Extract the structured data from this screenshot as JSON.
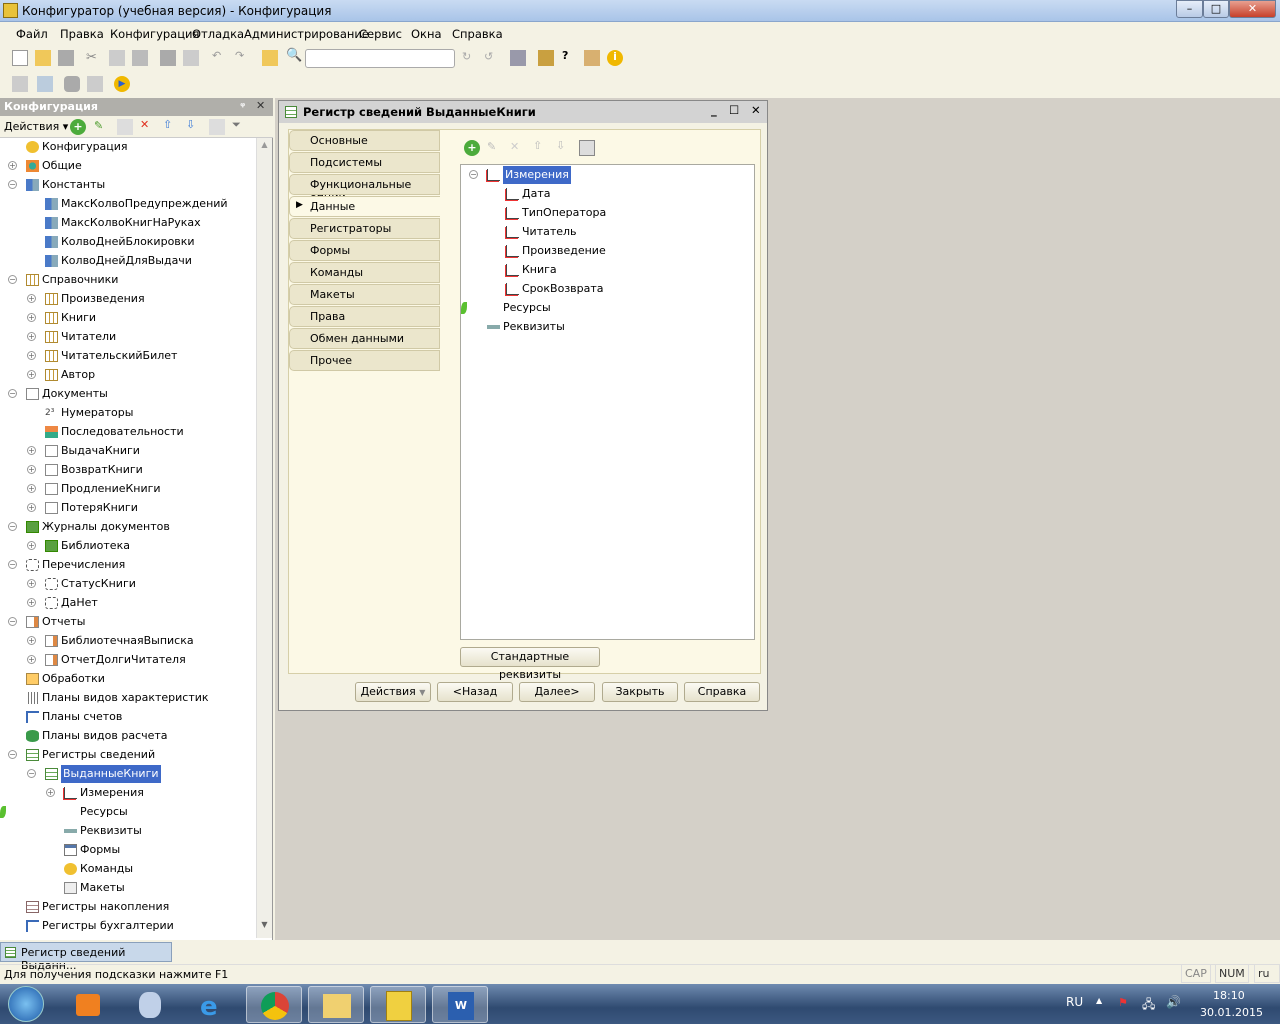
{
  "window": {
    "title": "Конфигуратор (учебная версия) - Конфигурация",
    "minimize": "–",
    "maximize": "□",
    "close": "✕"
  },
  "menu": [
    "Файл",
    "Правка",
    "Конфигурация",
    "Отладка",
    "Администрирование",
    "Сервис",
    "Окна",
    "Справка"
  ],
  "search": {
    "value": ""
  },
  "left_panel": {
    "title": "Конфигурация",
    "pin": "ᵠ",
    "close": "✕",
    "actions": "Действия ▾"
  },
  "tree": [
    {
      "l": 0,
      "e": "",
      "i": "config",
      "t": "Конфигурация"
    },
    {
      "l": 0,
      "e": "+",
      "i": "common",
      "t": "Общие"
    },
    {
      "l": 0,
      "e": "-",
      "i": "const",
      "t": "Константы"
    },
    {
      "l": 1,
      "e": "",
      "i": "const",
      "t": "МаксКолвоПредупреждений"
    },
    {
      "l": 1,
      "e": "",
      "i": "const",
      "t": "МаксКолвоКнигНаРуках"
    },
    {
      "l": 1,
      "e": "",
      "i": "const",
      "t": "КолвоДнейБлокировки"
    },
    {
      "l": 1,
      "e": "",
      "i": "const",
      "t": "КолвоДнейДляВыдачи"
    },
    {
      "l": 0,
      "e": "-",
      "i": "catalog",
      "t": "Справочники"
    },
    {
      "l": 1,
      "e": "+",
      "i": "catalog",
      "t": "Произведения"
    },
    {
      "l": 1,
      "e": "+",
      "i": "catalog",
      "t": "Книги"
    },
    {
      "l": 1,
      "e": "+",
      "i": "catalog",
      "t": "Читатели"
    },
    {
      "l": 1,
      "e": "+",
      "i": "catalog",
      "t": "ЧитательскийБилет"
    },
    {
      "l": 1,
      "e": "+",
      "i": "catalog",
      "t": "Автор"
    },
    {
      "l": 0,
      "e": "-",
      "i": "doc",
      "t": "Документы"
    },
    {
      "l": 1,
      "e": "",
      "i": "numerator",
      "t": "Нумераторы"
    },
    {
      "l": 1,
      "e": "",
      "i": "sequence",
      "t": "Последовательности"
    },
    {
      "l": 1,
      "e": "+",
      "i": "doc",
      "t": "ВыдачаКниги"
    },
    {
      "l": 1,
      "e": "+",
      "i": "doc",
      "t": "ВозвратКниги"
    },
    {
      "l": 1,
      "e": "+",
      "i": "doc",
      "t": "ПродлениеКниги"
    },
    {
      "l": 1,
      "e": "+",
      "i": "doc",
      "t": "ПотеряКниги"
    },
    {
      "l": 0,
      "e": "-",
      "i": "journal",
      "t": "Журналы документов"
    },
    {
      "l": 1,
      "e": "+",
      "i": "journal",
      "t": "Библиотека"
    },
    {
      "l": 0,
      "e": "-",
      "i": "enum",
      "t": "Перечисления"
    },
    {
      "l": 1,
      "e": "+",
      "i": "enum",
      "t": "СтатусКниги"
    },
    {
      "l": 1,
      "e": "+",
      "i": "enum",
      "t": "ДаНет"
    },
    {
      "l": 0,
      "e": "-",
      "i": "report",
      "t": "Отчеты"
    },
    {
      "l": 1,
      "e": "+",
      "i": "report",
      "t": "БиблиотечнаяВыписка"
    },
    {
      "l": 1,
      "e": "+",
      "i": "report",
      "t": "ОтчетДолгиЧитателя"
    },
    {
      "l": 0,
      "e": "",
      "i": "processing",
      "t": "Обработки"
    },
    {
      "l": 0,
      "e": "",
      "i": "chartchar",
      "t": "Планы видов характеристик"
    },
    {
      "l": 0,
      "e": "",
      "i": "accounts",
      "t": "Планы счетов"
    },
    {
      "l": 0,
      "e": "",
      "i": "calc",
      "t": "Планы видов расчета"
    },
    {
      "l": 0,
      "e": "-",
      "i": "inforeg",
      "t": "Регистры сведений"
    },
    {
      "l": 1,
      "e": "-",
      "i": "inforeg",
      "t": "ВыданныеКниги",
      "sel": true
    },
    {
      "l": 2,
      "e": "+",
      "i": "dimension",
      "t": "Измерения"
    },
    {
      "l": 2,
      "e": "",
      "i": "resource",
      "t": "Ресурсы"
    },
    {
      "l": 2,
      "e": "",
      "i": "attribute",
      "t": "Реквизиты"
    },
    {
      "l": 2,
      "e": "",
      "i": "form",
      "t": "Формы"
    },
    {
      "l": 2,
      "e": "",
      "i": "command",
      "t": "Команды"
    },
    {
      "l": 2,
      "e": "",
      "i": "template",
      "t": "Макеты"
    },
    {
      "l": 0,
      "e": "",
      "i": "accumreg",
      "t": "Регистры накопления"
    },
    {
      "l": 0,
      "e": "",
      "i": "accounts",
      "t": "Регистры бухгалтерии"
    }
  ],
  "dialog": {
    "title": "Регистр сведений ВыданныеКниги",
    "tabs": [
      "Основные",
      "Подсистемы",
      "Функциональные опции",
      "Данные",
      "Регистраторы",
      "Формы",
      "Команды",
      "Макеты",
      "Права",
      "Обмен данными",
      "Прочее"
    ],
    "active_tab": 3,
    "tree": [
      {
        "l": 0,
        "e": "-",
        "i": "dimension",
        "t": "Измерения",
        "sel": true
      },
      {
        "l": 1,
        "e": "",
        "i": "dimension",
        "t": "Дата"
      },
      {
        "l": 1,
        "e": "",
        "i": "dimension",
        "t": "ТипОператора"
      },
      {
        "l": 1,
        "e": "",
        "i": "dimension",
        "t": "Читатель"
      },
      {
        "l": 1,
        "e": "",
        "i": "dimension",
        "t": "Произведение"
      },
      {
        "l": 1,
        "e": "",
        "i": "dimension",
        "t": "Книга"
      },
      {
        "l": 1,
        "e": "",
        "i": "dimension",
        "t": "СрокВозврата"
      },
      {
        "l": 0,
        "e": "",
        "i": "resource",
        "t": "Ресурсы"
      },
      {
        "l": 0,
        "e": "",
        "i": "attribute",
        "t": "Реквизиты"
      }
    ],
    "std_attrs": "Стандартные реквизиты",
    "buttons": {
      "actions": "Действия",
      "back": "<Назад",
      "next": "Далее>",
      "close": "Закрыть",
      "help": "Справка"
    }
  },
  "window_tab": "Регистр сведений Выданн...",
  "status": {
    "hint": "Для получения подсказки нажмите F1",
    "cap": "CAP",
    "num": "NUM",
    "lang": "ru ▾"
  },
  "taskbar": {
    "lang": "RU",
    "time": "18:10",
    "date": "30.01.2015"
  }
}
